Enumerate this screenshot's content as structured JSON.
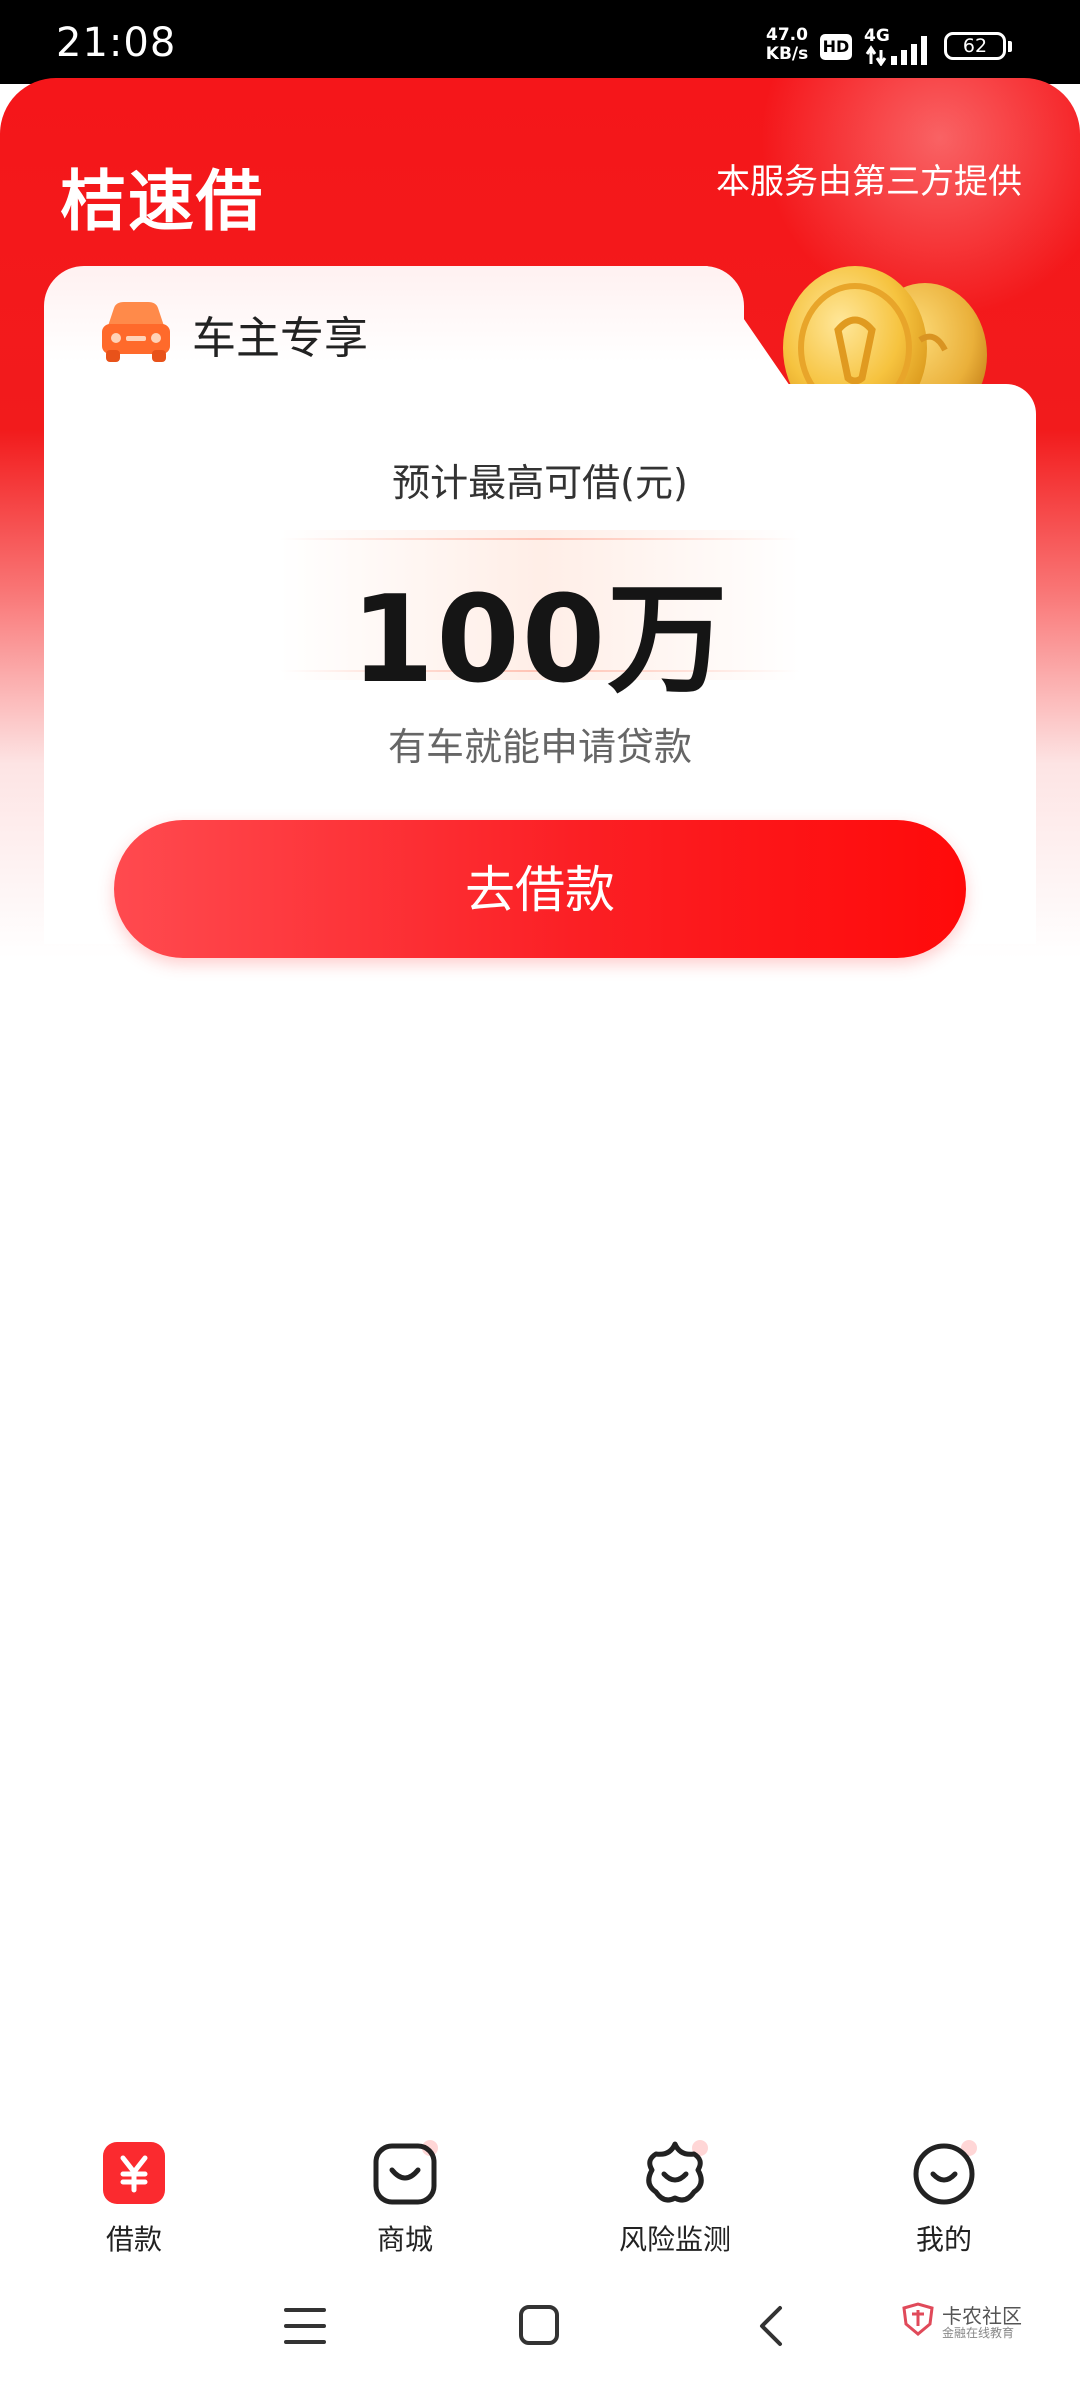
{
  "status_bar": {
    "time": "21:08",
    "net_speed_value": "47.0",
    "net_speed_unit": "KB/s",
    "hd_badge": "HD",
    "network_type": "4G",
    "battery": "62"
  },
  "header": {
    "logo": "桔速借",
    "provider_note": "本服务由第三方提供"
  },
  "card": {
    "tab_title": "车主专享",
    "estimate_label": "预计最高可借(元)",
    "amount": "100万",
    "subtitle": "有车就能申请贷款",
    "cta_label": "去借款"
  },
  "bottom_nav": {
    "items": [
      {
        "label": "借款",
        "icon": "yuan-icon",
        "active": true
      },
      {
        "label": "商城",
        "icon": "shopping-bag-icon",
        "active": false
      },
      {
        "label": "风险监测",
        "icon": "star-face-icon",
        "active": false
      },
      {
        "label": "我的",
        "icon": "smile-face-icon",
        "active": false
      }
    ]
  },
  "watermark": {
    "title": "卡农社区",
    "subtitle": "金融在线教育"
  },
  "colors": {
    "brand_red": "#f5161a",
    "button_red": "#fb1f24",
    "car_orange": "#ff6a2b"
  }
}
